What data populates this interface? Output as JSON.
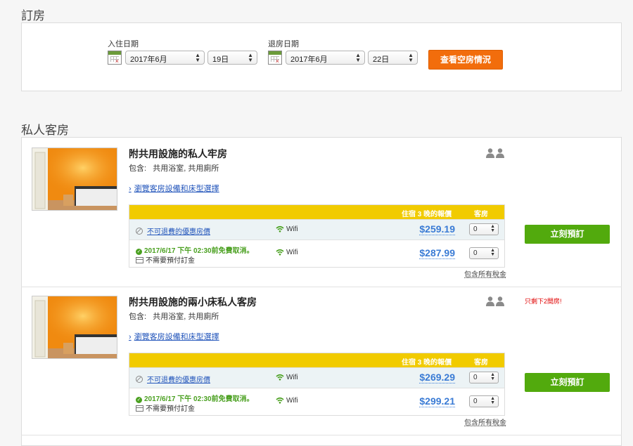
{
  "booking": {
    "heading": "訂房",
    "checkin": {
      "label": "入住日期",
      "month": "2017年6月",
      "day": "19日"
    },
    "checkout": {
      "label": "退房日期",
      "month": "2017年6月",
      "day": "22日"
    },
    "check_button": "查看空房情況"
  },
  "private_rooms": {
    "heading": "私人客房",
    "rooms": [
      {
        "title": "附共用設施的私人牢房",
        "includes_label": "包含:",
        "includes": "共用浴室, 共用廁所",
        "link": "瀏覽客房設備和床型選擇",
        "header_price": "住宿 3 晚的報價",
        "header_rooms": "客房",
        "rates": [
          {
            "type": "不可退費的優惠房價",
            "wifi": "Wifi",
            "price": "$259.19",
            "qty": "0"
          },
          {
            "cancel": "2017/6/17 下午 02:30前免費取消。",
            "deposit": "不需要預付訂金",
            "wifi": "Wifi",
            "price": "$287.99",
            "qty": "0"
          }
        ],
        "tax": "包含所有稅金",
        "book_button": "立刻預訂",
        "remaining": ""
      },
      {
        "title": "附共用設施的兩小床私人客房",
        "includes_label": "包含:",
        "includes": "共用浴室, 共用廁所",
        "link": "瀏覽客房設備和床型選擇",
        "header_price": "住宿 3 晚的報價",
        "header_rooms": "客房",
        "rates": [
          {
            "type": "不可退費的優惠房價",
            "wifi": "Wifi",
            "price": "$269.29",
            "qty": "0"
          },
          {
            "cancel": "2017/6/17 下午 02:30前免費取消。",
            "deposit": "不需要預付訂金",
            "wifi": "Wifi",
            "price": "$299.21",
            "qty": "0"
          }
        ],
        "tax": "包含所有稅金",
        "book_button": "立刻預訂",
        "remaining": "只剩下2間房!"
      }
    ]
  },
  "colors": {
    "accent_orange": "#f26d0c",
    "book_green": "#52aa0d",
    "table_header_yellow": "#f1cb00",
    "price_blue": "#3a7bd5",
    "cancel_green": "#4aa020",
    "warning_red": "#e00000"
  },
  "icons": [
    "calendar-icon",
    "people-icon",
    "wifi-icon",
    "no-refund-icon",
    "check-icon",
    "card-icon",
    "chevron-right-icon"
  ]
}
